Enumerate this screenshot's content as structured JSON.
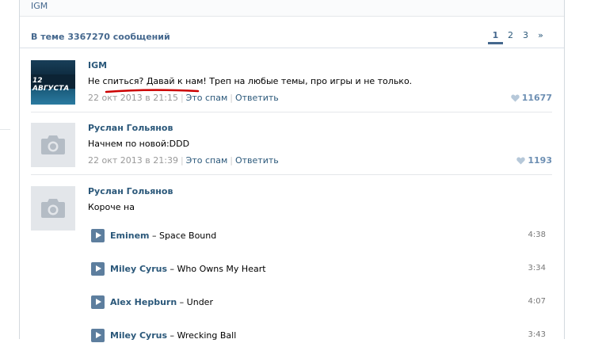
{
  "topbar": {
    "title": "IGM"
  },
  "header": {
    "count_text": "В теме 3367270 сообщений"
  },
  "pager": {
    "pages": [
      "1",
      "2",
      "3",
      "»"
    ]
  },
  "posts": [
    {
      "author": "IGM",
      "avatar_caption": "12 АВГУСТА",
      "text": "Не спиться? Давай к нам! Треп на любые темы, про игры и не только.",
      "date": "22 окт 2013 в 21:15",
      "spam": "Это спам",
      "reply": "Ответить",
      "likes": "11677"
    },
    {
      "author": "Руслан Гольянов",
      "text": "Начнем по новой:DDD",
      "date": "22 окт 2013 в 21:39",
      "spam": "Это спам",
      "reply": "Ответить",
      "likes": "1193"
    },
    {
      "author": "Руслан Гольянов",
      "text": "Короче на"
    }
  ],
  "tracks": [
    {
      "artist": "Eminem",
      "title": "Space Bound",
      "duration": "4:38"
    },
    {
      "artist": "Miley Cyrus",
      "title": "Who Owns My Heart",
      "duration": "3:34"
    },
    {
      "artist": "Alex Hepburn",
      "title": "Under",
      "duration": "4:07"
    },
    {
      "artist": "Miley Cyrus",
      "title": "Wrecking Ball",
      "duration": "3:43"
    }
  ],
  "colors": {
    "link": "#2b587a",
    "header": "#45688e",
    "annotation": "#cc0000"
  }
}
